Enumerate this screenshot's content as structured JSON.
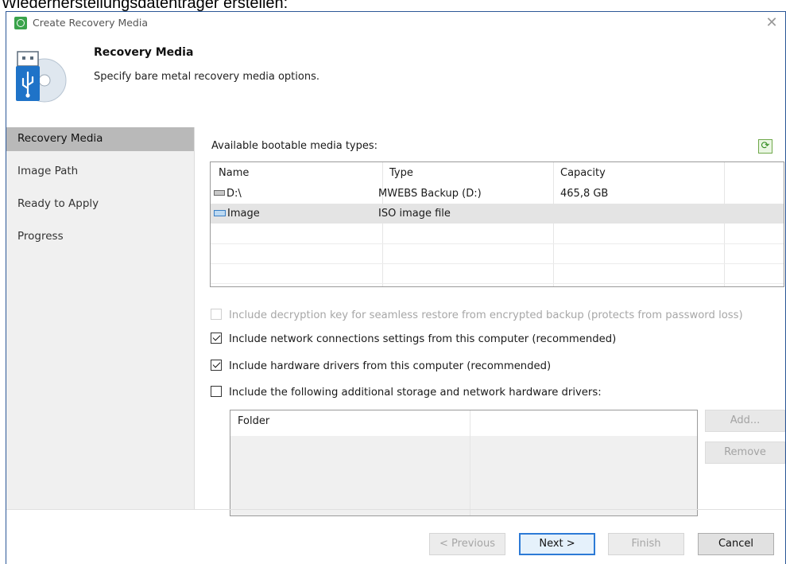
{
  "caption": "Wiederherstellungsdatenträger erstellen:",
  "window": {
    "title": "Create Recovery Media",
    "close_glyph": "✕"
  },
  "header": {
    "title": "Recovery Media",
    "subtitle": "Specify bare metal recovery media options.",
    "icon": "usb-disc-icon"
  },
  "sidebar": {
    "items": [
      {
        "label": "Recovery Media",
        "active": true
      },
      {
        "label": "Image Path",
        "active": false
      },
      {
        "label": "Ready to Apply",
        "active": false
      },
      {
        "label": "Progress",
        "active": false
      }
    ]
  },
  "media": {
    "label": "Available bootable media types:",
    "refresh_icon": "refresh-icon",
    "columns": [
      "Name",
      "Type",
      "Capacity",
      ""
    ],
    "rows": [
      {
        "icon": "drive-icon",
        "name": "D:\\",
        "type": "MWEBS Backup (D:)",
        "capacity": "465,8 GB",
        "selected": false
      },
      {
        "icon": "iso-image-icon",
        "name": "Image",
        "type": "ISO image file",
        "capacity": "",
        "selected": true
      }
    ]
  },
  "options": [
    {
      "label": "Include decryption key for seamless restore from encrypted backup (protects from password loss)",
      "checked": false,
      "disabled": true
    },
    {
      "label": "Include network connections settings from this computer (recommended)",
      "checked": true,
      "disabled": false
    },
    {
      "label": "Include hardware drivers from this computer (recommended)",
      "checked": true,
      "disabled": false
    },
    {
      "label": "Include the following additional storage and network hardware drivers:",
      "checked": false,
      "disabled": false
    }
  ],
  "drivers": {
    "columns": [
      "Folder",
      ""
    ],
    "add_label": "Add...",
    "remove_label": "Remove"
  },
  "footer": {
    "previous": "< Previous",
    "next": "Next >",
    "finish": "Finish",
    "cancel": "Cancel"
  },
  "colors": {
    "accent": "#2c7ad6",
    "selection": "#e4e4e4",
    "sidebar_active": "#b9b9b9",
    "app_icon": "#3aa34b"
  }
}
